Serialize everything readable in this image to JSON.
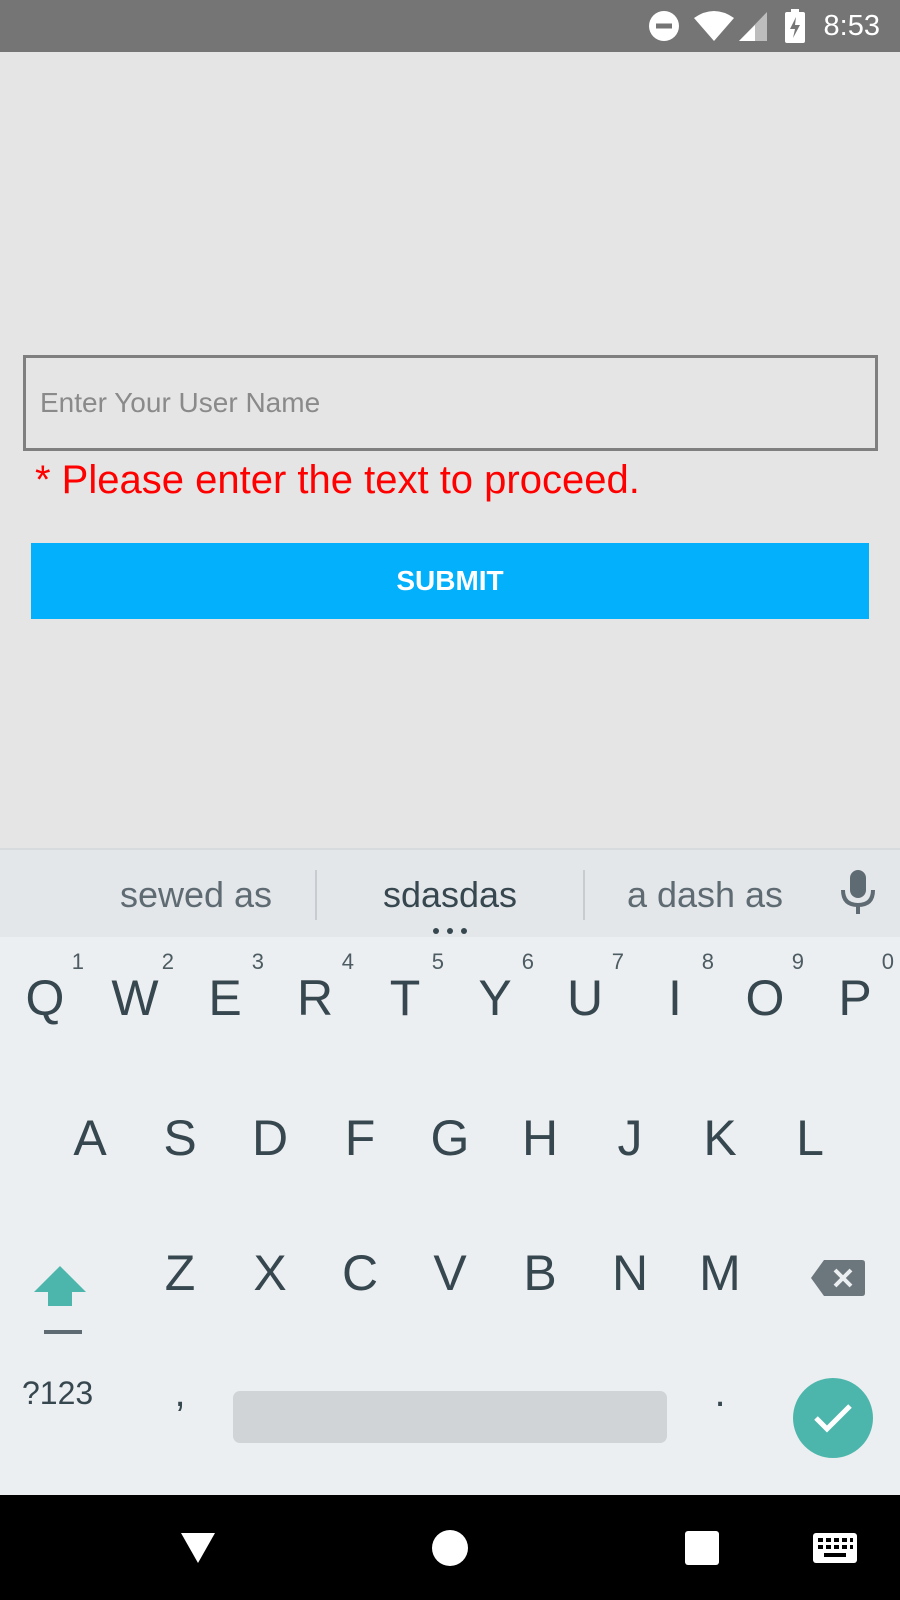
{
  "status_bar": {
    "time": "8:53",
    "icons": [
      "do-not-disturb-icon",
      "wifi-icon",
      "signal-icon",
      "battery-charging-icon"
    ]
  },
  "form": {
    "username_placeholder": "Enter Your User Name",
    "username_value": "",
    "error_message": "* Please enter the text to proceed.",
    "submit_label": "SUBMIT",
    "submit_color": "#03b0fb",
    "error_color": "#ff0000"
  },
  "keyboard": {
    "suggestions": [
      "sewed as",
      "sdasdas",
      "a dash as"
    ],
    "row1": [
      {
        "letter": "Q",
        "hint": "1"
      },
      {
        "letter": "W",
        "hint": "2"
      },
      {
        "letter": "E",
        "hint": "3"
      },
      {
        "letter": "R",
        "hint": "4"
      },
      {
        "letter": "T",
        "hint": "5"
      },
      {
        "letter": "Y",
        "hint": "6"
      },
      {
        "letter": "U",
        "hint": "7"
      },
      {
        "letter": "I",
        "hint": "8"
      },
      {
        "letter": "O",
        "hint": "9"
      },
      {
        "letter": "P",
        "hint": "0"
      }
    ],
    "row2": [
      "A",
      "S",
      "D",
      "F",
      "G",
      "H",
      "J",
      "K",
      "L"
    ],
    "row3": [
      "Z",
      "X",
      "C",
      "V",
      "B",
      "N",
      "M"
    ],
    "symbols_label": "?123",
    "comma_label": ",",
    "period_label": ".",
    "accent_color": "#4db6ac"
  },
  "nav_bar": {
    "icons": [
      "back-icon",
      "home-icon",
      "recents-icon",
      "keyboard-switch-icon"
    ]
  }
}
